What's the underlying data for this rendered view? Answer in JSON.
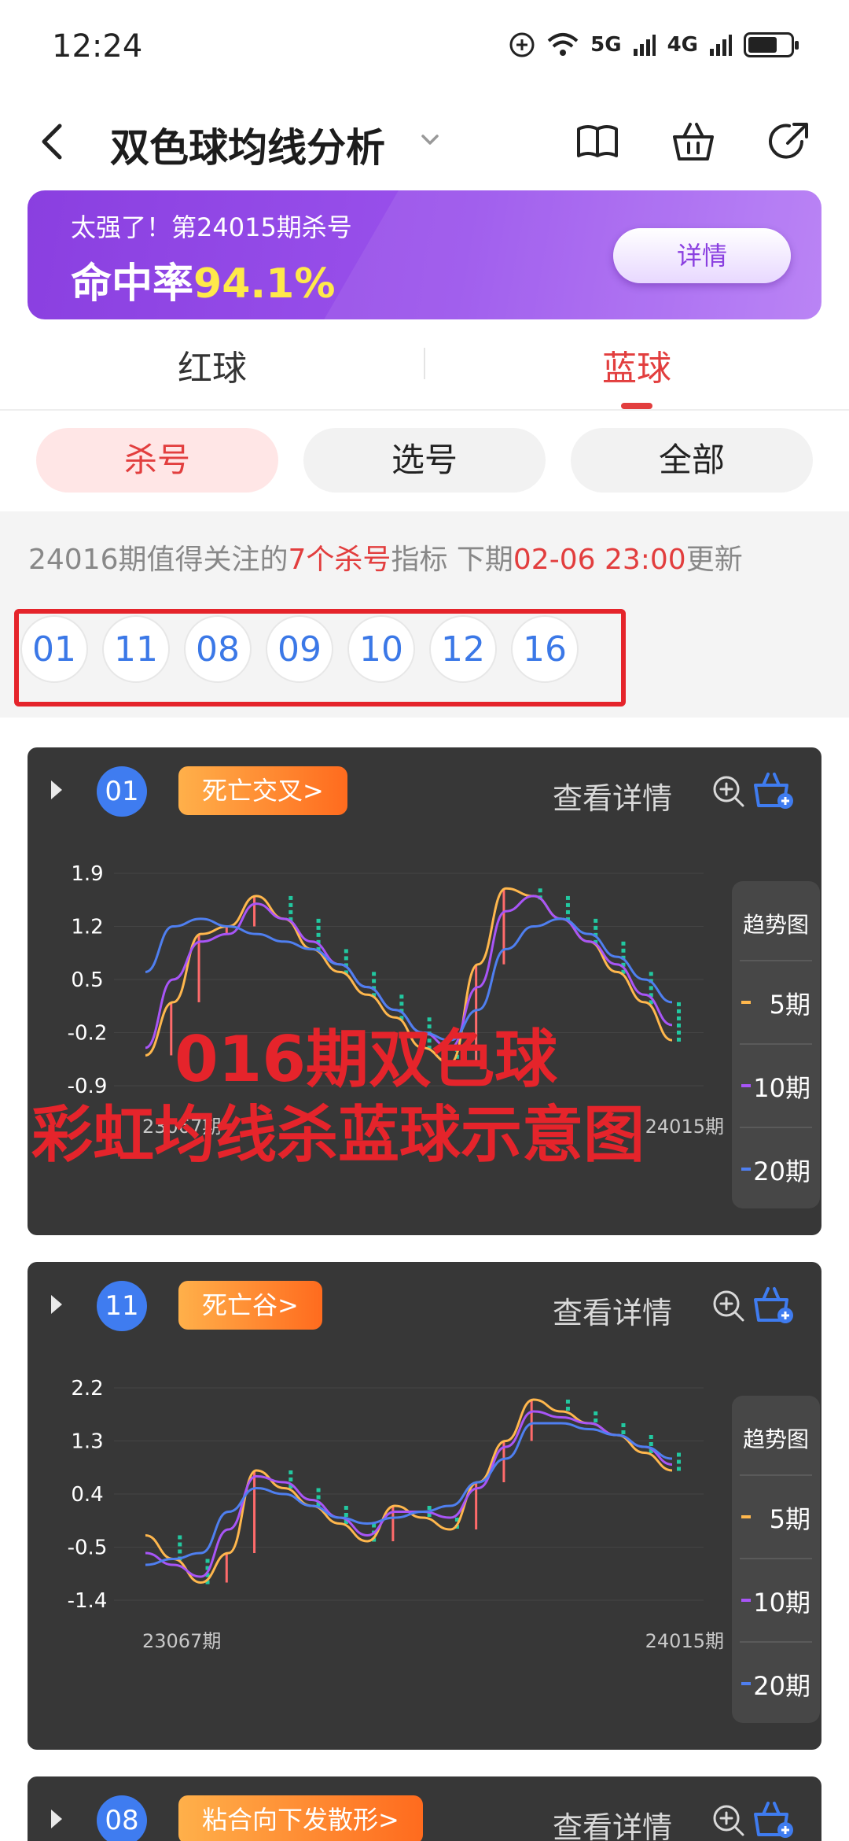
{
  "status": {
    "time": "12:24",
    "net1": "5G",
    "net2": "4G"
  },
  "header": {
    "title": "双色球均线分析"
  },
  "banner": {
    "line1": "太强了！第24015期杀号",
    "rate_label": "命中率",
    "rate_value": "94.1%",
    "detail": "详情"
  },
  "tabs": [
    {
      "label": "红球"
    },
    {
      "label": "蓝球"
    }
  ],
  "pills": [
    {
      "label": "杀号"
    },
    {
      "label": "选号"
    },
    {
      "label": "全部"
    }
  ],
  "notice": {
    "p1": "24016期值得关注的",
    "p2": "7个杀号",
    "p3": "指标 下期",
    "p4": "02-06 23:00",
    "p5": "更新"
  },
  "kill_numbers": [
    "01",
    "11",
    "08",
    "09",
    "10",
    "12",
    "16"
  ],
  "overlay": {
    "line1": "016期双色球",
    "line2": "彩虹均线杀蓝球示意图"
  },
  "legend": {
    "title": "趋势图",
    "items": [
      "5期",
      "10期",
      "20期"
    ]
  },
  "colors": {
    "accent_red": "#e23e3e",
    "ma5": "#ffb74d",
    "ma10": "#a855f7",
    "ma20": "#4f7ff0",
    "bull_bar": "#ff6b6b",
    "bear_bar": "#22c8a0"
  },
  "cards": [
    {
      "number": "01",
      "tag": "死亡交叉>",
      "see": "查看详情"
    },
    {
      "number": "11",
      "tag": "死亡谷>",
      "see": "查看详情"
    },
    {
      "number": "08",
      "tag": "粘合向下发散形>",
      "see": "查看详情"
    }
  ],
  "chart_data": [
    {
      "type": "line",
      "x_start_label": "23067期",
      "x_end_label": "24015期",
      "yticks": [
        "1.9",
        "1.2",
        "0.5",
        "-0.2",
        "-0.9"
      ],
      "ylim": [
        -0.9,
        1.9
      ],
      "series": [
        {
          "name": "5期",
          "values": [
            -0.5,
            0.2,
            1.1,
            1.2,
            1.6,
            1.3,
            0.9,
            0.6,
            0.3,
            0.0,
            -0.4,
            -0.6,
            0.7,
            1.7,
            1.6,
            1.3,
            1.0,
            0.6,
            0.2,
            -0.3
          ]
        },
        {
          "name": "10期",
          "values": [
            -0.4,
            0.5,
            1.0,
            1.1,
            1.5,
            1.3,
            1.0,
            0.7,
            0.4,
            0.1,
            -0.2,
            -0.4,
            0.4,
            1.4,
            1.6,
            1.3,
            1.0,
            0.7,
            0.3,
            -0.1
          ]
        },
        {
          "name": "20期",
          "values": [
            0.6,
            1.2,
            1.3,
            1.2,
            1.1,
            1.0,
            0.9,
            0.7,
            0.4,
            0.1,
            -0.2,
            -0.3,
            0.1,
            0.9,
            1.2,
            1.3,
            1.1,
            0.8,
            0.5,
            0.2
          ]
        }
      ]
    },
    {
      "type": "line",
      "x_start_label": "23067期",
      "x_end_label": "24015期",
      "yticks": [
        "2.2",
        "1.3",
        "0.4",
        "-0.5",
        "-1.4"
      ],
      "ylim": [
        -1.4,
        2.2
      ],
      "series": [
        {
          "name": "5期",
          "values": [
            -0.3,
            -0.7,
            -1.1,
            -0.6,
            0.8,
            0.5,
            0.2,
            -0.1,
            -0.4,
            0.2,
            0.0,
            -0.2,
            0.6,
            1.3,
            2.0,
            1.8,
            1.6,
            1.4,
            1.1,
            0.8
          ]
        },
        {
          "name": "10期",
          "values": [
            -0.6,
            -0.8,
            -1.0,
            -0.2,
            0.7,
            0.6,
            0.3,
            0.0,
            -0.3,
            0.1,
            0.1,
            0.0,
            0.5,
            1.2,
            1.8,
            1.7,
            1.6,
            1.4,
            1.2,
            0.9
          ]
        },
        {
          "name": "20期",
          "values": [
            -0.8,
            -0.7,
            -0.6,
            0.1,
            0.5,
            0.4,
            0.2,
            0.0,
            -0.1,
            0.0,
            0.1,
            0.2,
            0.6,
            1.0,
            1.6,
            1.6,
            1.5,
            1.4,
            1.2,
            1.0
          ]
        }
      ]
    }
  ]
}
